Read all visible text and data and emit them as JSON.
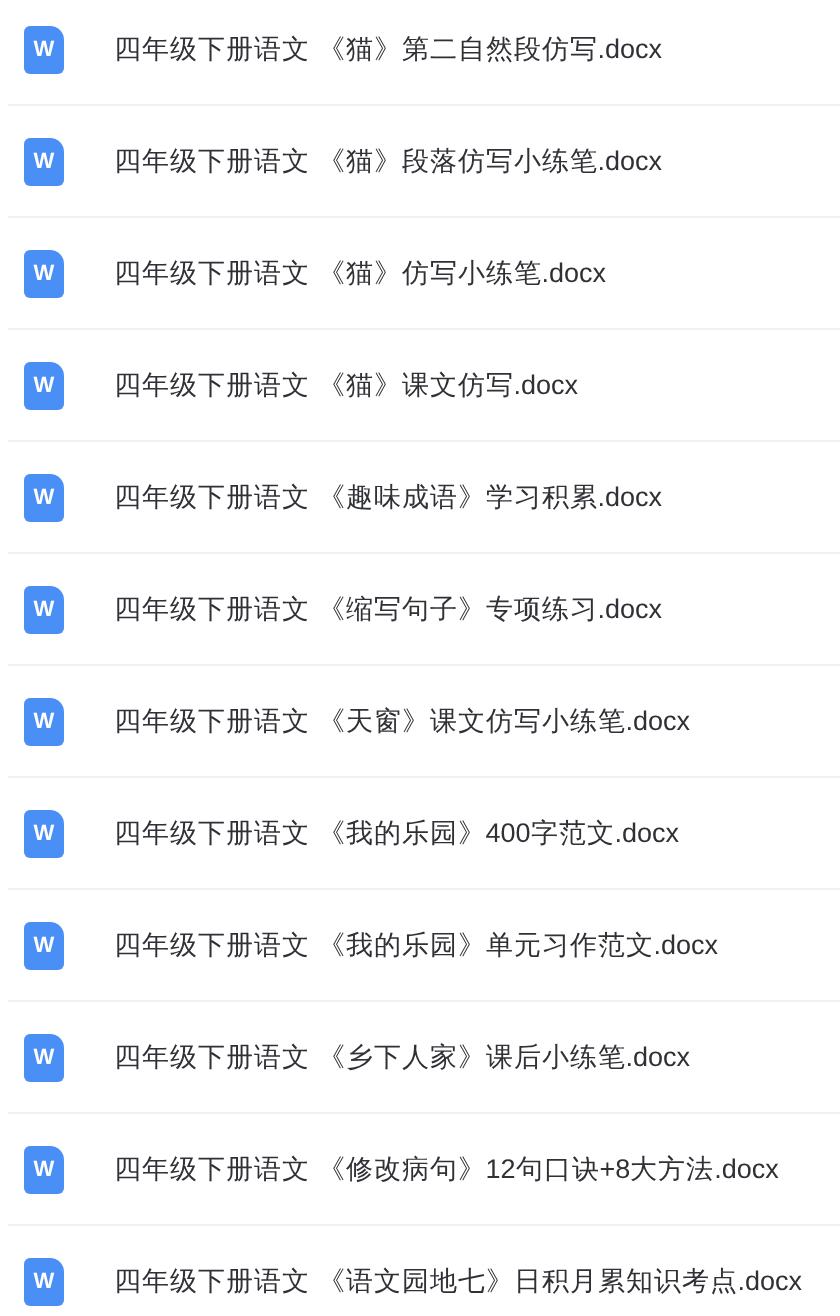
{
  "files": [
    {
      "icon_letter": "W",
      "name": "四年级下册语文 《猫》第二自然段仿写.docx"
    },
    {
      "icon_letter": "W",
      "name": "四年级下册语文 《猫》段落仿写小练笔.docx"
    },
    {
      "icon_letter": "W",
      "name": "四年级下册语文 《猫》仿写小练笔.docx"
    },
    {
      "icon_letter": "W",
      "name": "四年级下册语文 《猫》课文仿写.docx"
    },
    {
      "icon_letter": "W",
      "name": "四年级下册语文 《趣味成语》学习积累.docx"
    },
    {
      "icon_letter": "W",
      "name": "四年级下册语文 《缩写句子》专项练习.docx"
    },
    {
      "icon_letter": "W",
      "name": "四年级下册语文 《天窗》课文仿写小练笔.docx"
    },
    {
      "icon_letter": "W",
      "name": "四年级下册语文 《我的乐园》400字范文.docx"
    },
    {
      "icon_letter": "W",
      "name": "四年级下册语文 《我的乐园》单元习作范文.docx"
    },
    {
      "icon_letter": "W",
      "name": "四年级下册语文 《乡下人家》课后小练笔.docx"
    },
    {
      "icon_letter": "W",
      "name": "四年级下册语文 《修改病句》12句口诀+8大方法.docx"
    },
    {
      "icon_letter": "W",
      "name": "四年级下册语文 《语文园地七》日积月累知识考点.docx"
    }
  ]
}
